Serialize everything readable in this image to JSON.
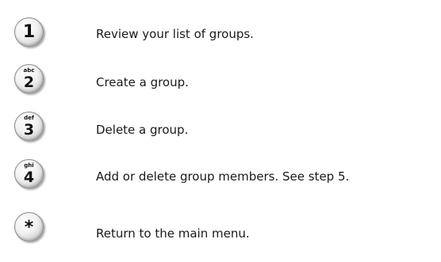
{
  "menu": {
    "items": [
      {
        "key_digit": "1",
        "key_letters": "",
        "icon": "keypad-1-icon",
        "text": "Review your list of groups."
      },
      {
        "key_digit": "2",
        "key_letters": "abc",
        "icon": "keypad-2-icon",
        "text": "Create a group."
      },
      {
        "key_digit": "3",
        "key_letters": "def",
        "icon": "keypad-3-icon",
        "text": "Delete a group."
      },
      {
        "key_digit": "4",
        "key_letters": "ghi",
        "icon": "keypad-4-icon",
        "text": "Add or delete group members. See step 5."
      },
      {
        "key_digit": "*",
        "key_letters": "",
        "icon": "keypad-star-icon",
        "text": "Return to the main menu."
      }
    ]
  }
}
